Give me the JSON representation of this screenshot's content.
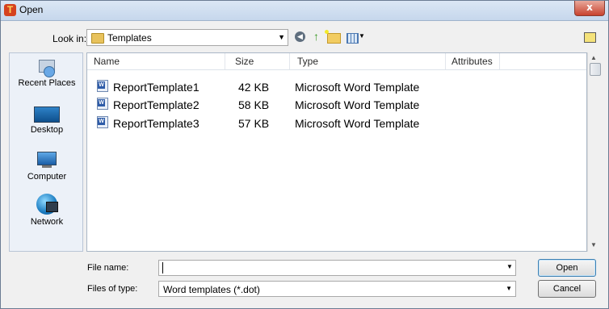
{
  "window": {
    "title": "Open",
    "close_label": "x"
  },
  "toolbar": {
    "look_in_label": "Look in:",
    "look_in_value": "Templates"
  },
  "places": [
    {
      "label": "Recent Places",
      "icon": "recent-places-icon"
    },
    {
      "label": "Desktop",
      "icon": "desktop-icon"
    },
    {
      "label": "Computer",
      "icon": "computer-icon"
    },
    {
      "label": "Network",
      "icon": "network-icon"
    }
  ],
  "list": {
    "columns": [
      "Name",
      "Size",
      "Type",
      "Attributes"
    ],
    "rows": [
      {
        "name": "ReportTemplate1",
        "size": "42 KB",
        "type": "Microsoft Word Template",
        "attributes": ""
      },
      {
        "name": "ReportTemplate2",
        "size": "58 KB",
        "type": "Microsoft Word Template",
        "attributes": ""
      },
      {
        "name": "ReportTemplate3",
        "size": "57 KB",
        "type": "Microsoft Word Template",
        "attributes": ""
      }
    ]
  },
  "footer": {
    "file_name_label": "File name:",
    "file_name_value": "",
    "file_type_label": "Files of type:",
    "file_type_value": "Word templates (*.dot)",
    "open_label": "Open",
    "cancel_label": "Cancel"
  }
}
